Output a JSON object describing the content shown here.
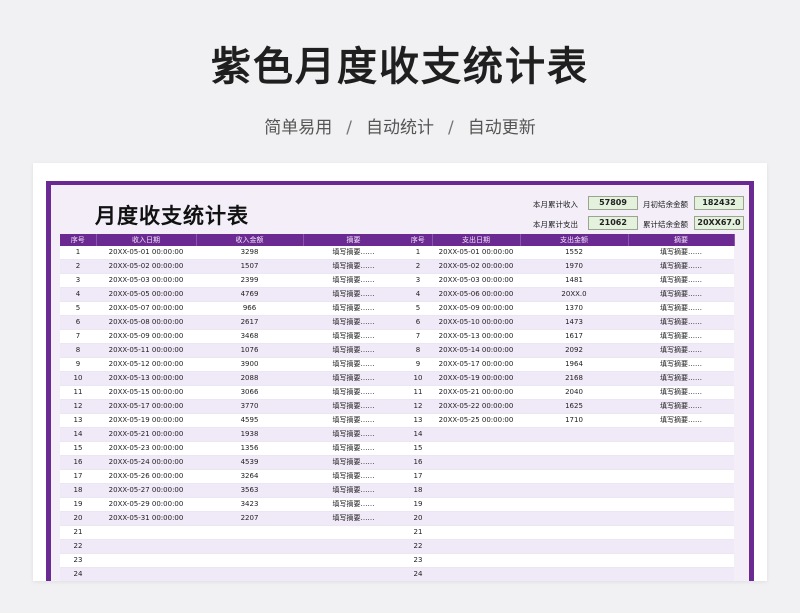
{
  "header": {
    "title": "紫色月度收支统计表",
    "subtitle_items": [
      "简单易用",
      "自动统计",
      "自动更新"
    ],
    "separator": "/"
  },
  "sheet": {
    "title": "月度收支统计表",
    "summary": {
      "income_total_label": "本月累计收入",
      "income_total_value": "57809",
      "expense_total_label": "本月累计支出",
      "expense_total_value": "21062",
      "opening_balance_label": "月初结余金额",
      "opening_balance_value": "182432",
      "closing_balance_label": "累计结余金额",
      "closing_balance_value": "20XX67.0"
    },
    "income_table": {
      "columns": [
        "序号",
        "收入日期",
        "收入金额",
        "摘要"
      ],
      "rows": [
        [
          "1",
          "20XX-05-01 00:00:00",
          "3298",
          "填写摘要……"
        ],
        [
          "2",
          "20XX-05-02 00:00:00",
          "1507",
          "填写摘要……"
        ],
        [
          "3",
          "20XX-05-03 00:00:00",
          "2399",
          "填写摘要……"
        ],
        [
          "4",
          "20XX-05-05 00:00:00",
          "4769",
          "填写摘要……"
        ],
        [
          "5",
          "20XX-05-07 00:00:00",
          "966",
          "填写摘要……"
        ],
        [
          "6",
          "20XX-05-08 00:00:00",
          "2617",
          "填写摘要……"
        ],
        [
          "7",
          "20XX-05-09 00:00:00",
          "3468",
          "填写摘要……"
        ],
        [
          "8",
          "20XX-05-11 00:00:00",
          "1076",
          "填写摘要……"
        ],
        [
          "9",
          "20XX-05-12 00:00:00",
          "3900",
          "填写摘要……"
        ],
        [
          "10",
          "20XX-05-13 00:00:00",
          "2088",
          "填写摘要……"
        ],
        [
          "11",
          "20XX-05-15 00:00:00",
          "3066",
          "填写摘要……"
        ],
        [
          "12",
          "20XX-05-17 00:00:00",
          "3770",
          "填写摘要……"
        ],
        [
          "13",
          "20XX-05-19 00:00:00",
          "4595",
          "填写摘要……"
        ],
        [
          "14",
          "20XX-05-21 00:00:00",
          "1938",
          "填写摘要……"
        ],
        [
          "15",
          "20XX-05-23 00:00:00",
          "1356",
          "填写摘要……"
        ],
        [
          "16",
          "20XX-05-24 00:00:00",
          "4539",
          "填写摘要……"
        ],
        [
          "17",
          "20XX-05-26 00:00:00",
          "3264",
          "填写摘要……"
        ],
        [
          "18",
          "20XX-05-27 00:00:00",
          "3563",
          "填写摘要……"
        ],
        [
          "19",
          "20XX-05-29 00:00:00",
          "3423",
          "填写摘要……"
        ],
        [
          "20",
          "20XX-05-31 00:00:00",
          "2207",
          "填写摘要……"
        ],
        [
          "21",
          "",
          "",
          ""
        ],
        [
          "22",
          "",
          "",
          ""
        ],
        [
          "23",
          "",
          "",
          ""
        ],
        [
          "24",
          "",
          "",
          ""
        ]
      ]
    },
    "expense_table": {
      "columns": [
        "序号",
        "支出日期",
        "支出金额",
        "摘要"
      ],
      "rows": [
        [
          "1",
          "20XX-05-01 00:00:00",
          "1552",
          "填写摘要……"
        ],
        [
          "2",
          "20XX-05-02 00:00:00",
          "1970",
          "填写摘要……"
        ],
        [
          "3",
          "20XX-05-03 00:00:00",
          "1481",
          "填写摘要……"
        ],
        [
          "4",
          "20XX-05-06 00:00:00",
          "20XX.0",
          "填写摘要……"
        ],
        [
          "5",
          "20XX-05-09 00:00:00",
          "1370",
          "填写摘要……"
        ],
        [
          "6",
          "20XX-05-10 00:00:00",
          "1473",
          "填写摘要……"
        ],
        [
          "7",
          "20XX-05-13 00:00:00",
          "1617",
          "填写摘要……"
        ],
        [
          "8",
          "20XX-05-14 00:00:00",
          "2092",
          "填写摘要……"
        ],
        [
          "9",
          "20XX-05-17 00:00:00",
          "1964",
          "填写摘要……"
        ],
        [
          "10",
          "20XX-05-19 00:00:00",
          "2168",
          "填写摘要……"
        ],
        [
          "11",
          "20XX-05-21 00:00:00",
          "2040",
          "填写摘要……"
        ],
        [
          "12",
          "20XX-05-22 00:00:00",
          "1625",
          "填写摘要……"
        ],
        [
          "13",
          "20XX-05-25 00:00:00",
          "1710",
          "填写摘要……"
        ],
        [
          "14",
          "",
          "",
          ""
        ],
        [
          "15",
          "",
          "",
          ""
        ],
        [
          "16",
          "",
          "",
          ""
        ],
        [
          "17",
          "",
          "",
          ""
        ],
        [
          "18",
          "",
          "",
          ""
        ],
        [
          "19",
          "",
          "",
          ""
        ],
        [
          "20",
          "",
          "",
          ""
        ],
        [
          "21",
          "",
          "",
          ""
        ],
        [
          "22",
          "",
          "",
          ""
        ],
        [
          "23",
          "",
          "",
          ""
        ],
        [
          "24",
          "",
          "",
          ""
        ]
      ]
    }
  },
  "colors": {
    "accent_purple": "#6b2a92",
    "row_alt": "#f0e9f7",
    "summary_box": "#e4f1dd"
  }
}
